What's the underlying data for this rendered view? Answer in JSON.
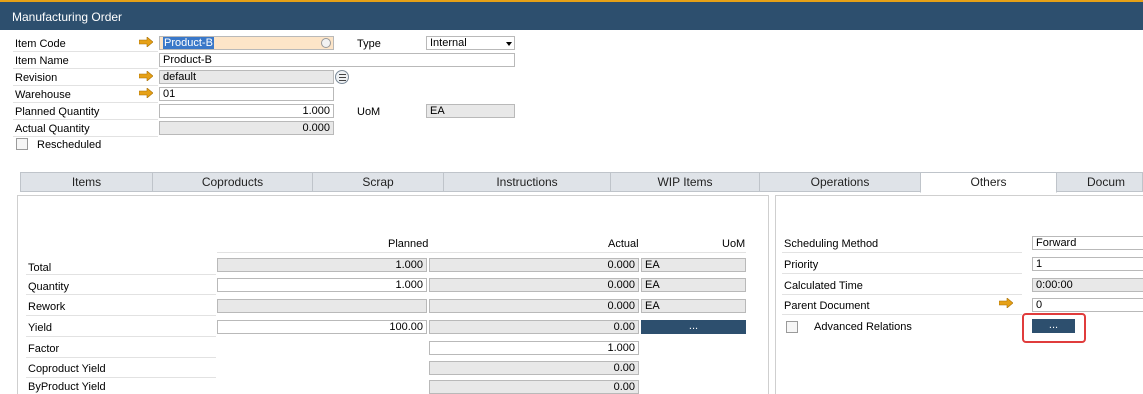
{
  "window": {
    "title": "Manufacturing Order"
  },
  "header": {
    "item_code": {
      "label": "Item Code",
      "value": "Product-B"
    },
    "type": {
      "label": "Type",
      "value": "Internal"
    },
    "item_name": {
      "label": "Item Name",
      "value": "Product-B"
    },
    "revision": {
      "label": "Revision",
      "value": "default"
    },
    "warehouse": {
      "label": "Warehouse",
      "value": "01"
    },
    "planned_quantity": {
      "label": "Planned Quantity",
      "value": "1.000"
    },
    "uom": {
      "label": "UoM",
      "value": "EA"
    },
    "actual_quantity": {
      "label": "Actual Quantity",
      "value": "0.000"
    },
    "rescheduled": {
      "label": "Rescheduled",
      "checked": false
    }
  },
  "tabs": [
    "Items",
    "Coproducts",
    "Scrap",
    "Instructions",
    "WIP Items",
    "Operations",
    "Others",
    "Docum"
  ],
  "active_tab": "Others",
  "quantities": {
    "headers": {
      "planned": "Planned",
      "actual": "Actual",
      "uom": "UoM"
    },
    "rows": [
      {
        "label": "Total",
        "planned": "1.000",
        "actual": "0.000",
        "uom": "EA"
      },
      {
        "label": "Quantity",
        "planned": "1.000",
        "actual": "0.000",
        "uom": "EA"
      },
      {
        "label": "Rework",
        "planned": "",
        "actual": "0.000",
        "uom": "EA"
      },
      {
        "label": "Yield",
        "planned": "100.00",
        "actual": "0.00",
        "uom": "..."
      },
      {
        "label": "Factor",
        "planned": "",
        "actual": "1.000",
        "uom": ""
      },
      {
        "label": "Coproduct Yield",
        "planned": "",
        "actual": "0.00",
        "uom": ""
      },
      {
        "label": "ByProduct Yield",
        "planned": "",
        "actual": "0.00",
        "uom": ""
      }
    ]
  },
  "others": {
    "scheduling_method": {
      "label": "Scheduling Method",
      "value": "Forward"
    },
    "priority": {
      "label": "Priority",
      "value": "1"
    },
    "calculated_time": {
      "label": "Calculated Time",
      "value": "0:00:00"
    },
    "parent_document": {
      "label": "Parent Document",
      "value": "0"
    },
    "advanced_relations": {
      "label": "Advanced Relations",
      "button": "...",
      "checked": false
    }
  },
  "colors": {
    "titlebar": "#2d4f6e",
    "accent": "#e6a117",
    "highlight": "#e03c3c"
  }
}
